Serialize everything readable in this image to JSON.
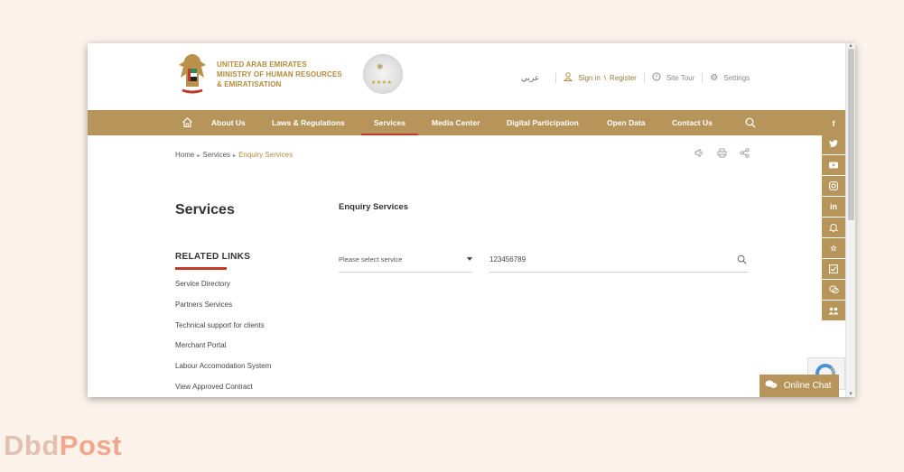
{
  "header": {
    "ministry_lines": [
      "UNITED ARAB EMIRATES",
      "MINISTRY OF HUMAN RESOURCES",
      "& EMIRATISATION"
    ],
    "language_link": "عربي",
    "sign_in": "Sign in",
    "link_separator": "\\",
    "register": "Register",
    "site_tour": "Site Tour",
    "settings": "Settings"
  },
  "nav": {
    "items": [
      "About Us",
      "Laws & Regulations",
      "Services",
      "Media Center",
      "Digital Participation",
      "Open Data",
      "Contact Us"
    ],
    "active": "Services"
  },
  "breadcrumb": [
    "Home",
    "Services",
    "Enquiry Services"
  ],
  "page": {
    "title": "Services",
    "section_title": "Enquiry Services",
    "related_title": "RELATED LINKS",
    "related_links": [
      "Service Directory",
      "Partners Services",
      "Technical support for clients",
      "Merchant Portal",
      "Labour Accomodation System",
      "View Approved Contract"
    ]
  },
  "form": {
    "service_select_value": "Please select service",
    "search_value": "123456789"
  },
  "social": [
    "f",
    "t",
    "yt",
    "ig",
    "in",
    "bell",
    "star",
    "check",
    "chat",
    "people"
  ],
  "chat_label": "Online Chat",
  "watermark": {
    "part1": "Dbd",
    "part2": "Post"
  },
  "colors": {
    "gold": "#b7955a",
    "accent_red": "#c0392b",
    "text_gold": "#b28a3c"
  }
}
